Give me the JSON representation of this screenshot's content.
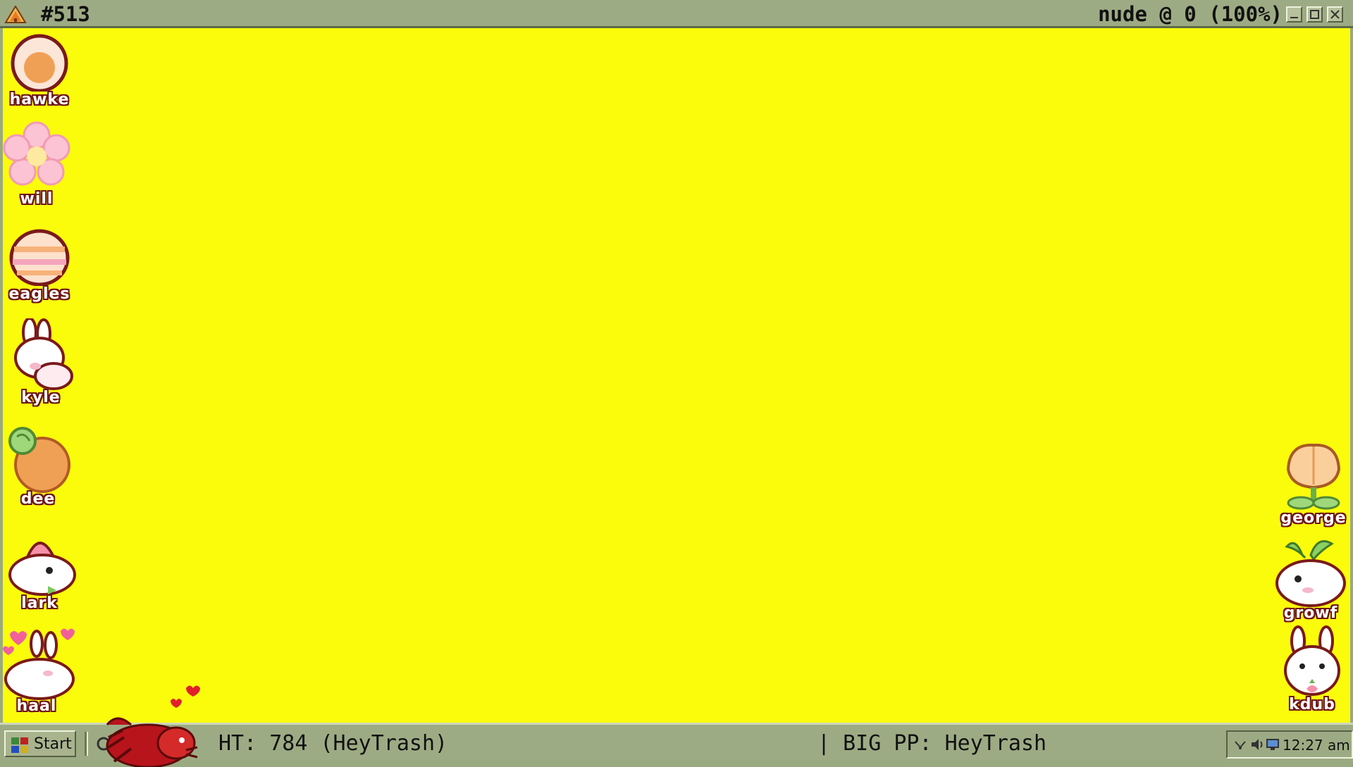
{
  "window": {
    "title": "#513",
    "status": "nude @ 0 (100%)",
    "app_icon": "tree-icon",
    "controls": [
      "minimize-icon",
      "maximize-icon",
      "close-icon"
    ]
  },
  "desktop": {
    "background": "#fbfc0c",
    "icons_left": [
      {
        "label": "hawke",
        "icon": "egg-icon"
      },
      {
        "label": "will",
        "icon": "flower-icon"
      },
      {
        "label": "eagles",
        "icon": "striped-egg-icon"
      },
      {
        "label": "kyle",
        "icon": "bunny-icon"
      },
      {
        "label": "dee",
        "icon": "carrot-icon"
      },
      {
        "label": "lark",
        "icon": "strawberry-bunny-icon"
      },
      {
        "label": "haal",
        "icon": "heart-bunny-icon"
      }
    ],
    "icons_right": [
      {
        "label": "george",
        "icon": "tulip-icon"
      },
      {
        "label": "growf",
        "icon": "sprout-bunny-icon"
      },
      {
        "label": "kdub",
        "icon": "bunny-icon"
      }
    ]
  },
  "taskbar": {
    "start_label": "Start",
    "ticker_left": "HT: 784 (HeyTrash)",
    "ticker_right": "| BIG PP: HeyTrash",
    "clock": "12:27 am",
    "tray_icons": [
      "network-icon",
      "volume-icon",
      "monitor-icon"
    ]
  }
}
